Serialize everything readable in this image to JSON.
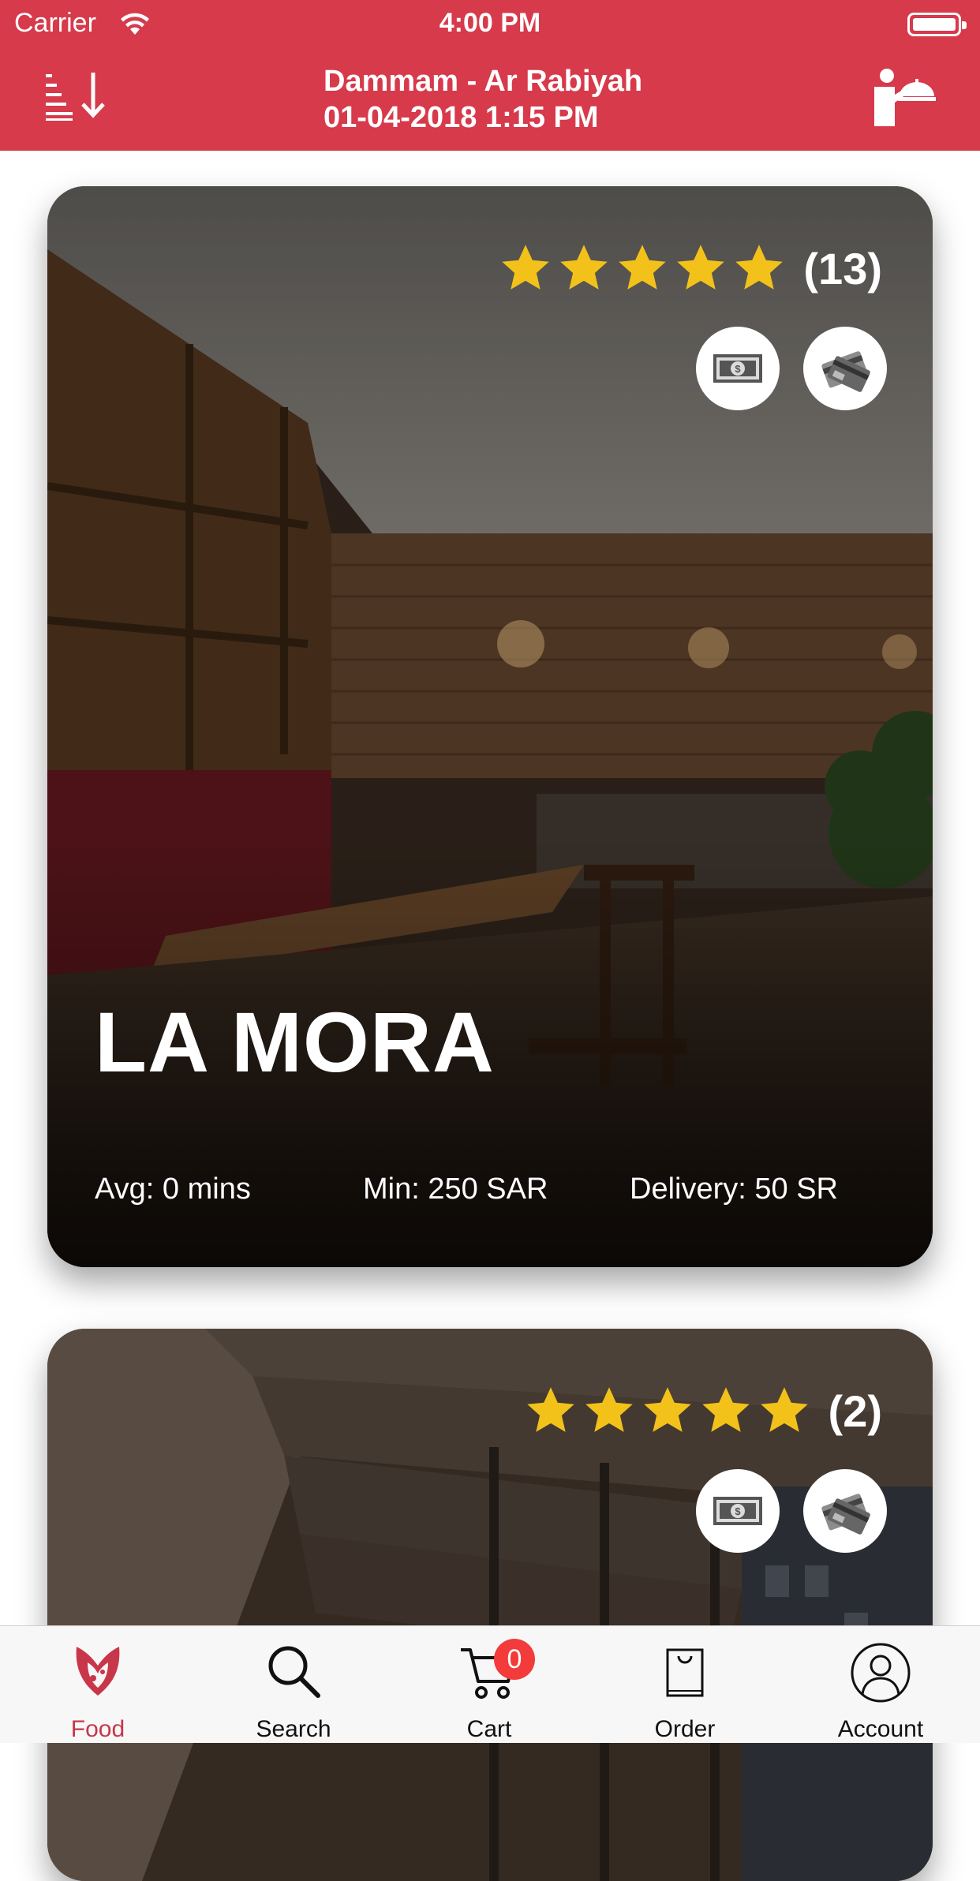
{
  "status_bar": {
    "carrier": "Carrier",
    "time": "4:00 PM"
  },
  "header": {
    "location": "Dammam - Ar Rabiyah",
    "datetime": "01-04-2018 1:15 PM"
  },
  "colors": {
    "brand": "#d63a4b",
    "star": "#f2c21a",
    "badge": "#f33b3b"
  },
  "restaurants": [
    {
      "name": "LA MORA",
      "rating": 5,
      "reviews": "(13)",
      "payment_methods": [
        "cash-icon",
        "credit-card-icon"
      ],
      "avg": "Avg: 0 mins",
      "min": "Min: 250 SAR",
      "delivery": "Delivery: 50 SR"
    },
    {
      "rating": 5,
      "reviews": "(2)",
      "payment_methods": [
        "cash-icon",
        "credit-card-icon"
      ]
    }
  ],
  "tabbar": {
    "food": "Food",
    "search": "Search",
    "cart": "Cart",
    "cart_badge": "0",
    "order": "Order",
    "account": "Account"
  }
}
